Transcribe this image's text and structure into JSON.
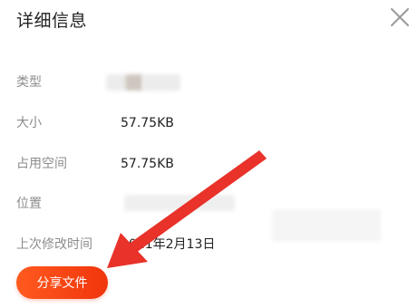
{
  "dialog": {
    "title": "详细信息",
    "close_icon": "close-icon"
  },
  "details": [
    {
      "label": "类型",
      "value": ""
    },
    {
      "label": "大小",
      "value": "57.75KB"
    },
    {
      "label": "占用空间",
      "value": "57.75KB"
    },
    {
      "label": "位置",
      "value": ""
    },
    {
      "label": "上次修改时间",
      "value": "2021年2月13日"
    }
  ],
  "actions": {
    "share_label": "分享文件"
  },
  "colors": {
    "share_button": "#f0350c",
    "annotation_arrow": "#e8322a",
    "label_text": "#8c8c8c"
  }
}
